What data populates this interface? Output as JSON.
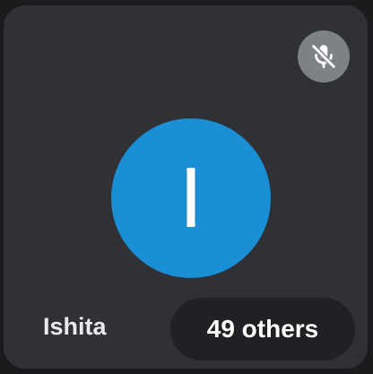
{
  "participant": {
    "name": "Ishita",
    "initial": "I",
    "avatar_color": "#1a8fd6",
    "muted": true,
    "mute_icon": "mic-off-icon"
  },
  "others": {
    "label": "49 others"
  },
  "colors": {
    "tile_background": "#303134",
    "pill_background": "#202124",
    "badge_background": "#7e8185"
  }
}
